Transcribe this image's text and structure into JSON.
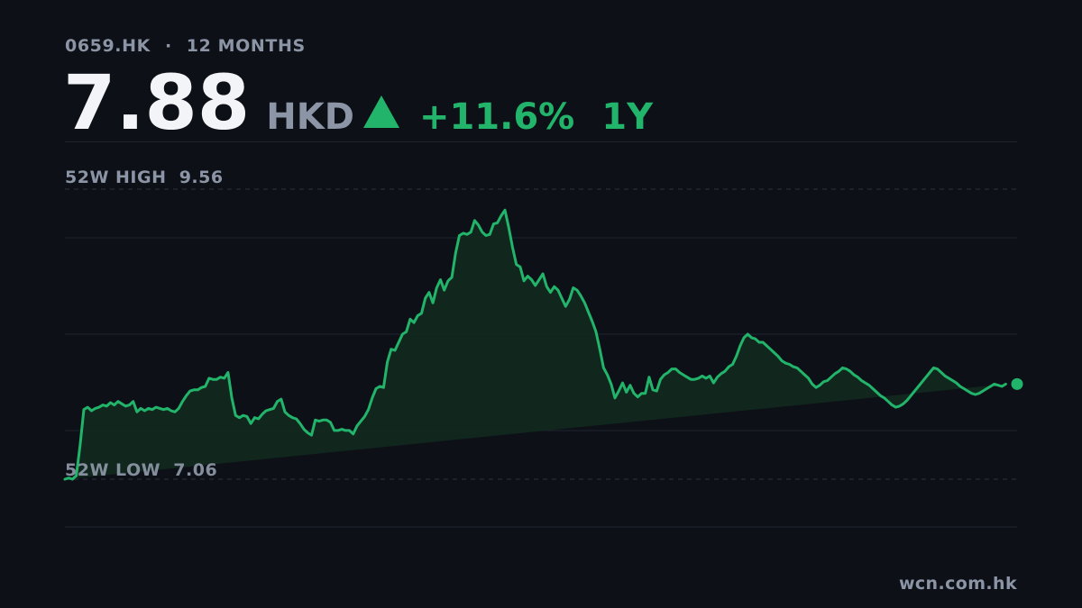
{
  "header": {
    "ticker": "0659.HK",
    "separator": "·",
    "period_label": "12 MONTHS",
    "price": "7.88",
    "currency": "HKD",
    "change": "+11.6%",
    "range": "1Y"
  },
  "watermark": "wcn.com.hk",
  "colors": {
    "background": "#0d1017",
    "accent_up": "#22b46a",
    "muted_text": "#8c95a5",
    "grid": "#1f242d",
    "area_fill": "#12291f"
  },
  "chart_data": {
    "type": "area",
    "title": "",
    "xlabel": "",
    "ylabel": "",
    "ylim": [
      6.05,
      9.6
    ],
    "high": {
      "label": "52W HIGH",
      "value": "9.56"
    },
    "low": {
      "label": "52W LOW",
      "value": "7.06"
    },
    "grid": true,
    "x": [
      0,
      1,
      2,
      3,
      4,
      5,
      6,
      7,
      8,
      9,
      10,
      11,
      12,
      13,
      14,
      15,
      16,
      17,
      18,
      19,
      20,
      21,
      22,
      23,
      24,
      25,
      26,
      27,
      28,
      29,
      30,
      31,
      32,
      33,
      34,
      35,
      36,
      37,
      38,
      39,
      40,
      41,
      42,
      43,
      44,
      45,
      46,
      47,
      48,
      49,
      50,
      51,
      52,
      53,
      54,
      55,
      56,
      57,
      58,
      59,
      60,
      61,
      62,
      63,
      64,
      65,
      66,
      67,
      68,
      69,
      70,
      71,
      72,
      73,
      74,
      75,
      76,
      77,
      78,
      79,
      80,
      81,
      82,
      83,
      84,
      85,
      86,
      87,
      88,
      89,
      90,
      91,
      92,
      93,
      94,
      95,
      96,
      97,
      98,
      99,
      100,
      101,
      102,
      103,
      104,
      105,
      106,
      107,
      108,
      109,
      110,
      111,
      112,
      113,
      114,
      115,
      116,
      117,
      118,
      119,
      120,
      121,
      122,
      123,
      124,
      125,
      126,
      127,
      128,
      129,
      130,
      131,
      132,
      133,
      134,
      135,
      136,
      137,
      138,
      139,
      140,
      141,
      142,
      143,
      144,
      145,
      146,
      147,
      148,
      149,
      150,
      151,
      152,
      153,
      154,
      155,
      156,
      157,
      158,
      159,
      160,
      161,
      162,
      163,
      164,
      165,
      166,
      167,
      168,
      169,
      170,
      171,
      172,
      173,
      174,
      175,
      176,
      177,
      178,
      179,
      180,
      181,
      182,
      183,
      184,
      185,
      186,
      187,
      188,
      189,
      190,
      191,
      192,
      193,
      194,
      195,
      196,
      197,
      198,
      199,
      200,
      201,
      202,
      203,
      204,
      205,
      206,
      207,
      208,
      209,
      210,
      211,
      212,
      213,
      214,
      215,
      216,
      217,
      218,
      219,
      220,
      221,
      222,
      223,
      224,
      225,
      226,
      227,
      228,
      229,
      230,
      231,
      232,
      233,
      234,
      235,
      236,
      237,
      238,
      239,
      240,
      241,
      242,
      243,
      244,
      245,
      246,
      247,
      248,
      249,
      250,
      251
    ],
    "series": [
      {
        "values": [
          7.06,
          7.07,
          7.06,
          7.09,
          7.35,
          7.66,
          7.68,
          7.65,
          7.67,
          7.68,
          7.7,
          7.69,
          7.72,
          7.7,
          7.73,
          7.71,
          7.69,
          7.7,
          7.73,
          7.64,
          7.67,
          7.65,
          7.67,
          7.66,
          7.68,
          7.67,
          7.66,
          7.67,
          7.65,
          7.64,
          7.67,
          7.73,
          7.78,
          7.82,
          7.83,
          7.83,
          7.85,
          7.86,
          7.93,
          7.92,
          7.92,
          7.94,
          7.93,
          7.98,
          7.76,
          7.61,
          7.59,
          7.61,
          7.6,
          7.54,
          7.59,
          7.58,
          7.62,
          7.65,
          7.66,
          7.67,
          7.73,
          7.75,
          7.64,
          7.61,
          7.59,
          7.58,
          7.54,
          7.49,
          7.46,
          7.44,
          7.57,
          7.56,
          7.57,
          7.57,
          7.55,
          7.48,
          7.48,
          7.49,
          7.48,
          7.48,
          7.45,
          7.52,
          7.56,
          7.6,
          7.66,
          7.76,
          7.84,
          7.86,
          7.85,
          8.07,
          8.18,
          8.17,
          8.24,
          8.31,
          8.33,
          8.44,
          8.41,
          8.47,
          8.49,
          8.62,
          8.67,
          8.58,
          8.71,
          8.78,
          8.69,
          8.77,
          8.8,
          9.01,
          9.16,
          9.18,
          9.17,
          9.19,
          9.29,
          9.25,
          9.19,
          9.16,
          9.17,
          9.26,
          9.27,
          9.33,
          9.38,
          9.23,
          9.06,
          8.91,
          8.89,
          8.77,
          8.81,
          8.78,
          8.73,
          8.78,
          8.83,
          8.72,
          8.67,
          8.72,
          8.69,
          8.62,
          8.55,
          8.61,
          8.71,
          8.69,
          8.64,
          8.58,
          8.5,
          8.42,
          8.33,
          8.18,
          8.02,
          7.96,
          7.88,
          7.76,
          7.82,
          7.89,
          7.81,
          7.87,
          7.8,
          7.77,
          7.8,
          7.8,
          7.94,
          7.83,
          7.82,
          7.92,
          7.96,
          7.98,
          8.01,
          8.01,
          7.98,
          7.96,
          7.94,
          7.92,
          7.92,
          7.93,
          7.95,
          7.93,
          7.95,
          7.89,
          7.94,
          7.97,
          7.99,
          8.03,
          8.05,
          8.12,
          8.21,
          8.28,
          8.31,
          8.28,
          8.27,
          8.24,
          8.24,
          8.21,
          8.18,
          8.15,
          8.12,
          8.08,
          8.06,
          8.05,
          8.03,
          8.02,
          7.99,
          7.96,
          7.93,
          7.88,
          7.85,
          7.87,
          7.9,
          7.91,
          7.94,
          7.97,
          7.99,
          8.02,
          8.01,
          7.99,
          7.96,
          7.94,
          7.91,
          7.89,
          7.87,
          7.84,
          7.81,
          7.78,
          7.76,
          7.73,
          7.7,
          7.68,
          7.69,
          7.71,
          7.74,
          7.78,
          7.82,
          7.86,
          7.9,
          7.94,
          7.98,
          8.02,
          8.01,
          7.98,
          7.95,
          7.93,
          7.91,
          7.89,
          7.86,
          7.84,
          7.82,
          7.8,
          7.79,
          7.8,
          7.82,
          7.84,
          7.86,
          7.88,
          7.87,
          7.86,
          7.88
        ]
      }
    ]
  }
}
